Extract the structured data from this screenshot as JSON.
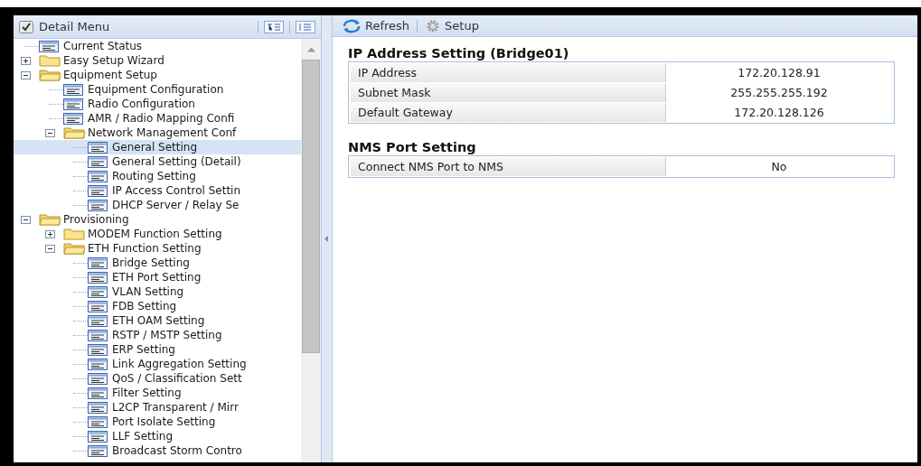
{
  "sidebar": {
    "title": "Detail Menu",
    "items": [
      {
        "label": "Current Status",
        "kind": "page",
        "selected": false
      },
      {
        "label": "Easy Setup Wizard",
        "kind": "folder",
        "expanded": false,
        "selected": false
      },
      {
        "label": "Equipment Setup",
        "kind": "folder",
        "expanded": true,
        "selected": false,
        "children": [
          {
            "label": "Equipment Configuration",
            "kind": "page",
            "selected": false
          },
          {
            "label": "Radio Configuration",
            "kind": "page",
            "selected": false
          },
          {
            "label": "AMR / Radio Mapping Confi",
            "kind": "page",
            "selected": false
          },
          {
            "label": "Network Management Conf",
            "kind": "folder",
            "expanded": true,
            "selected": false,
            "children": [
              {
                "label": "General Setting",
                "kind": "page",
                "selected": true
              },
              {
                "label": "General Setting (Detail)",
                "kind": "page",
                "selected": false
              },
              {
                "label": "Routing Setting",
                "kind": "page",
                "selected": false
              },
              {
                "label": "IP Access Control Settin",
                "kind": "page",
                "selected": false
              },
              {
                "label": "DHCP Server / Relay Se",
                "kind": "page",
                "selected": false
              }
            ]
          }
        ]
      },
      {
        "label": "Provisioning",
        "kind": "folder",
        "expanded": true,
        "selected": false,
        "children": [
          {
            "label": "MODEM Function Setting",
            "kind": "folder",
            "expanded": false,
            "selected": false
          },
          {
            "label": "ETH Function Setting",
            "kind": "folder",
            "expanded": true,
            "selected": false,
            "children": [
              {
                "label": "Bridge Setting",
                "kind": "page",
                "selected": false
              },
              {
                "label": "ETH Port Setting",
                "kind": "page",
                "selected": false
              },
              {
                "label": "VLAN Setting",
                "kind": "page",
                "selected": false
              },
              {
                "label": "FDB Setting",
                "kind": "page",
                "selected": false
              },
              {
                "label": "ETH OAM Setting",
                "kind": "page",
                "selected": false
              },
              {
                "label": "RSTP / MSTP Setting",
                "kind": "page",
                "selected": false
              },
              {
                "label": "ERP Setting",
                "kind": "page",
                "selected": false
              },
              {
                "label": "Link Aggregation Setting",
                "kind": "page",
                "selected": false
              },
              {
                "label": "QoS / Classification Sett",
                "kind": "page",
                "selected": false
              },
              {
                "label": "Filter Setting",
                "kind": "page",
                "selected": false
              },
              {
                "label": "L2CP Transparent / Mirr",
                "kind": "page",
                "selected": false
              },
              {
                "label": "Port Isolate Setting",
                "kind": "page",
                "selected": false
              },
              {
                "label": "LLF Setting",
                "kind": "page",
                "selected": false
              },
              {
                "label": "Broadcast Storm Contro",
                "kind": "page",
                "selected": false
              }
            ]
          }
        ]
      }
    ]
  },
  "toolbar": {
    "buttons": [
      {
        "label": "Refresh",
        "kind": "refresh"
      },
      {
        "label": "Setup",
        "kind": "setup"
      }
    ]
  },
  "sections": [
    {
      "title": "IP Address Setting (Bridge01)",
      "rows": [
        {
          "label": "IP Address",
          "value": "172.20.128.91"
        },
        {
          "label": "Subnet Mask",
          "value": "255.255.255.192"
        },
        {
          "label": "Default Gateway",
          "value": "172.20.128.126"
        }
      ]
    },
    {
      "title": "NMS Port Setting",
      "rows": [
        {
          "label": "Connect NMS Port to NMS",
          "value": "No"
        }
      ]
    }
  ]
}
